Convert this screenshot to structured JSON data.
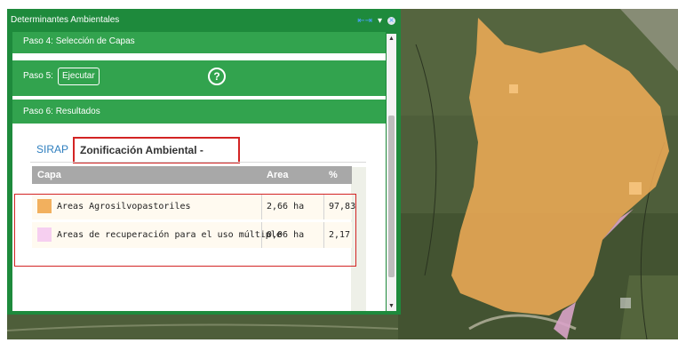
{
  "window": {
    "title": "Determinantes Ambientales",
    "close_icon": "close-icon",
    "collapse_icon": "collapse-arrows-icon"
  },
  "steps": {
    "step4_label": "Paso 4: Selección de Capas",
    "step5_label": "Paso 5:",
    "execute_button": "Ejecutar",
    "help_icon": "?",
    "step6_label": "Paso 6: Resultados"
  },
  "tabs": {
    "sirap": "SIRAP",
    "zonificacion": "Zonificación Ambiental - POMCAS"
  },
  "table": {
    "headers": {
      "capa": "Capa",
      "area": "Area",
      "pct": "%"
    },
    "rows": [
      {
        "color": "#f2b05e",
        "capa": "Areas Agrosilvopastoriles",
        "area": "2,66 ha",
        "pct": "97,83"
      },
      {
        "color": "#f6cff0",
        "capa": "Areas de recuperación para el uso múltiple",
        "area": "0,06 ha",
        "pct": "2,17"
      }
    ]
  },
  "colors": {
    "panel_green": "#1e8a3c",
    "step_green": "#32a34e",
    "highlight_red": "#d32424",
    "polygon_orange": "#f2ad57",
    "polygon_pink": "#d9a3c8"
  }
}
